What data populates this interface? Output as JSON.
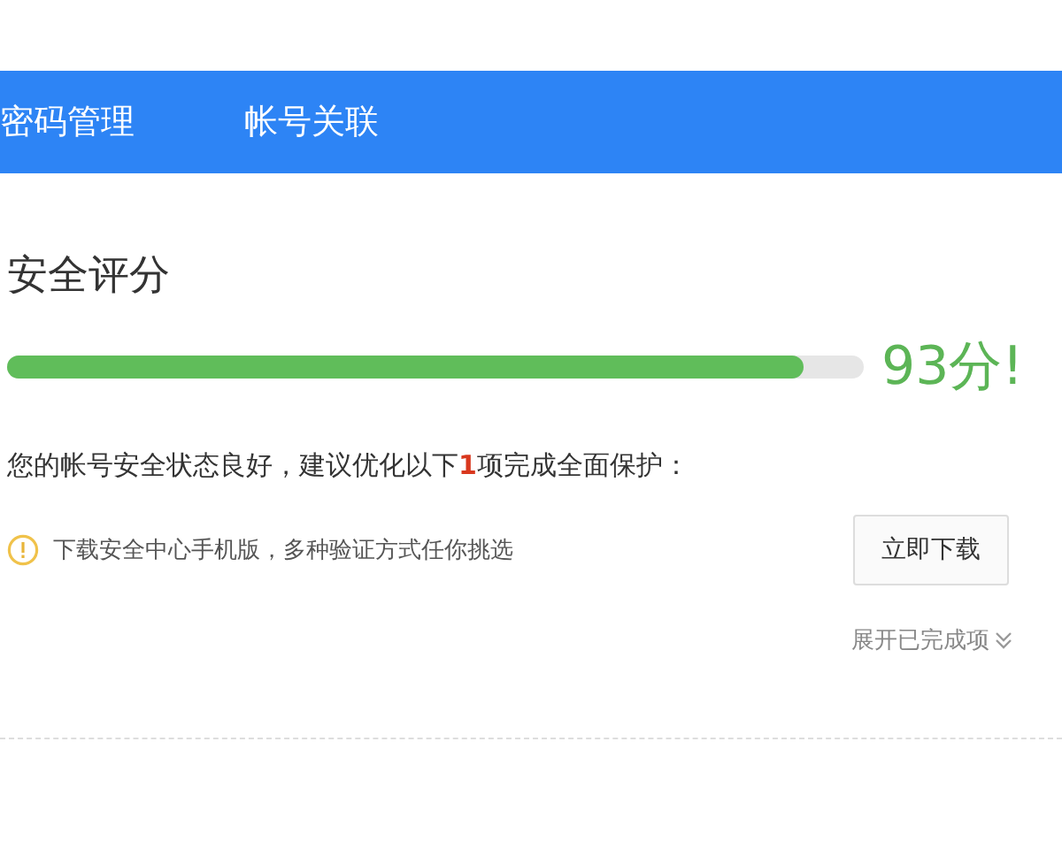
{
  "tabs": [
    {
      "label": "密码管理"
    },
    {
      "label": "帐号关联"
    }
  ],
  "score": {
    "title": "安全评分",
    "level": 0.93,
    "reading": "93分!"
  },
  "summary": "您的帐号安全状态良好，建议优化以下**1**项完成全面保护：",
  "tasks": [
    {
      "text": "下载安全中心手机版，多种验证方式任你挑选",
      "button": "立即下载"
    }
  ],
  "expand_link": "展开已完成项"
}
